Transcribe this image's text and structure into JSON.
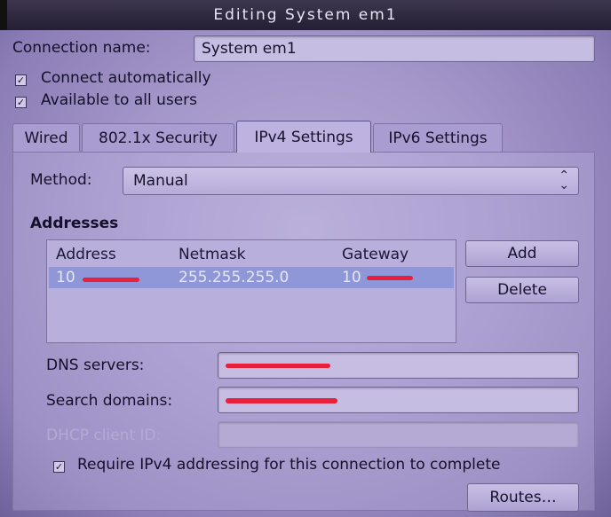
{
  "window": {
    "title": "Editing System em1"
  },
  "connection": {
    "name_label": "Connection name:",
    "name_value": "System em1"
  },
  "options": {
    "connect_automatically": {
      "label": "Connect automatically",
      "checked": true
    },
    "available_to_all": {
      "label": "Available to all users",
      "checked": true
    }
  },
  "tabs": [
    {
      "label": "Wired",
      "active": false
    },
    {
      "label": "802.1x Security",
      "active": false
    },
    {
      "label": "IPv4 Settings",
      "active": true
    },
    {
      "label": "IPv6 Settings",
      "active": false
    }
  ],
  "method": {
    "label": "Method:",
    "value": "Manual"
  },
  "addresses": {
    "heading": "Addresses",
    "columns": [
      "Address",
      "Netmask",
      "Gateway"
    ],
    "rows": [
      {
        "address": "10",
        "netmask": "255.255.255.0",
        "gateway": "10"
      }
    ],
    "add_label": "Add",
    "delete_label": "Delete"
  },
  "dns": {
    "label": "DNS servers:"
  },
  "search": {
    "label": "Search domains:"
  },
  "dhcp": {
    "label": "DHCP client ID:"
  },
  "require": {
    "label": "Require IPv4 addressing for this connection to complete",
    "checked": true
  },
  "routes_label": "Routes…",
  "colors": {
    "redaction": "#e8203a",
    "selection": "#8f97d8"
  }
}
